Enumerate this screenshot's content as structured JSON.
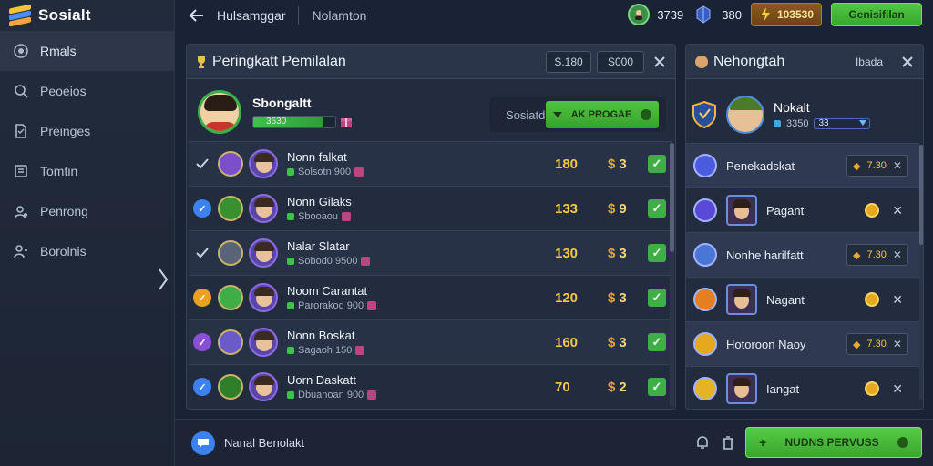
{
  "app": {
    "title": "Sosialt"
  },
  "sidebar": {
    "items": [
      {
        "label": "Rmals",
        "icon": "profile-circle-icon",
        "active": true
      },
      {
        "label": "Peoeios",
        "icon": "search-icon",
        "active": false
      },
      {
        "label": "Preinges",
        "icon": "document-icon",
        "active": false
      },
      {
        "label": "Tomtin",
        "icon": "list-icon",
        "active": false
      },
      {
        "label": "Penrong",
        "icon": "users-icon",
        "active": false
      },
      {
        "label": "Borolnis",
        "icon": "group-icon",
        "active": false
      }
    ]
  },
  "topbar": {
    "crumb_primary": "Hulsamggar",
    "crumb_secondary": "Nolamton",
    "stats": [
      {
        "value": "3739",
        "icon": "player-avatar-icon"
      },
      {
        "value": "380",
        "icon": "gem-icon"
      }
    ],
    "coins": "103530",
    "action_label": "Genisifilan"
  },
  "leaderboard": {
    "title": "Peringkatt Pemilalan",
    "chip_a": "S.180",
    "chip_b": "S000",
    "player": {
      "name": "Sbongaltt",
      "xp_label": "3630",
      "xp_fill": 0.85
    },
    "search_label": "Sosiatd",
    "add_label": "AK PROGAE",
    "rows": [
      {
        "lead": "check",
        "name": "Nonn falkat",
        "sub": "Solsotn 900",
        "score": "180",
        "coins": "3",
        "emblem_color": "#7b4fc9"
      },
      {
        "lead": "blue",
        "name": "Nonn Gilaks",
        "sub": "Sbooaou",
        "score": "133",
        "coins": "9",
        "emblem_color": "#3a8f2f"
      },
      {
        "lead": "check",
        "name": "Nalar Slatar",
        "sub": "Sobod0 9500",
        "score": "130",
        "coins": "3",
        "emblem_color": "#5a6478"
      },
      {
        "lead": "orange",
        "name": "Noom Carantat",
        "sub": "Parorakod 900",
        "score": "120",
        "coins": "3",
        "emblem_color": "#3fae46"
      },
      {
        "lead": "purple",
        "name": "Nonn Boskat",
        "sub": "Sagaoh 150",
        "score": "160",
        "coins": "3",
        "emblem_color": "#6b5ac9"
      },
      {
        "lead": "blue",
        "name": "Uorn Daskatt",
        "sub": "Dbuanoan 900",
        "score": "70",
        "coins": "2",
        "emblem_color": "#2f7f2a"
      }
    ]
  },
  "right_panel": {
    "title": "Nehongtah",
    "action": "Ibada",
    "card": {
      "name": "Nokalt",
      "sub": "3350",
      "bar_value": "33"
    },
    "rows": [
      {
        "name": "Penekadskat",
        "pill": "7.30",
        "hl": true,
        "kind": "pill",
        "icon_color": "#4a5be0"
      },
      {
        "name": "Pagant",
        "hl": false,
        "kind": "actions",
        "icon_color": "#5a49d6"
      },
      {
        "name": "Nonhe harilfatt",
        "pill": "7.30",
        "hl": true,
        "kind": "pill",
        "icon_color": "#4a76d6"
      },
      {
        "name": "Nagant",
        "hl": false,
        "kind": "actions",
        "icon_color": "#e67e22"
      },
      {
        "name": "Hotoroon Naoy",
        "pill": "7.30",
        "hl": true,
        "kind": "pill",
        "icon_color": "#e6a91e"
      },
      {
        "name": "Iangat",
        "hl": false,
        "kind": "actions",
        "icon_color": "#e6b422"
      }
    ]
  },
  "bottombar": {
    "label": "Nanal Benolakt",
    "button_label": "NUDNS PERVUSS"
  }
}
